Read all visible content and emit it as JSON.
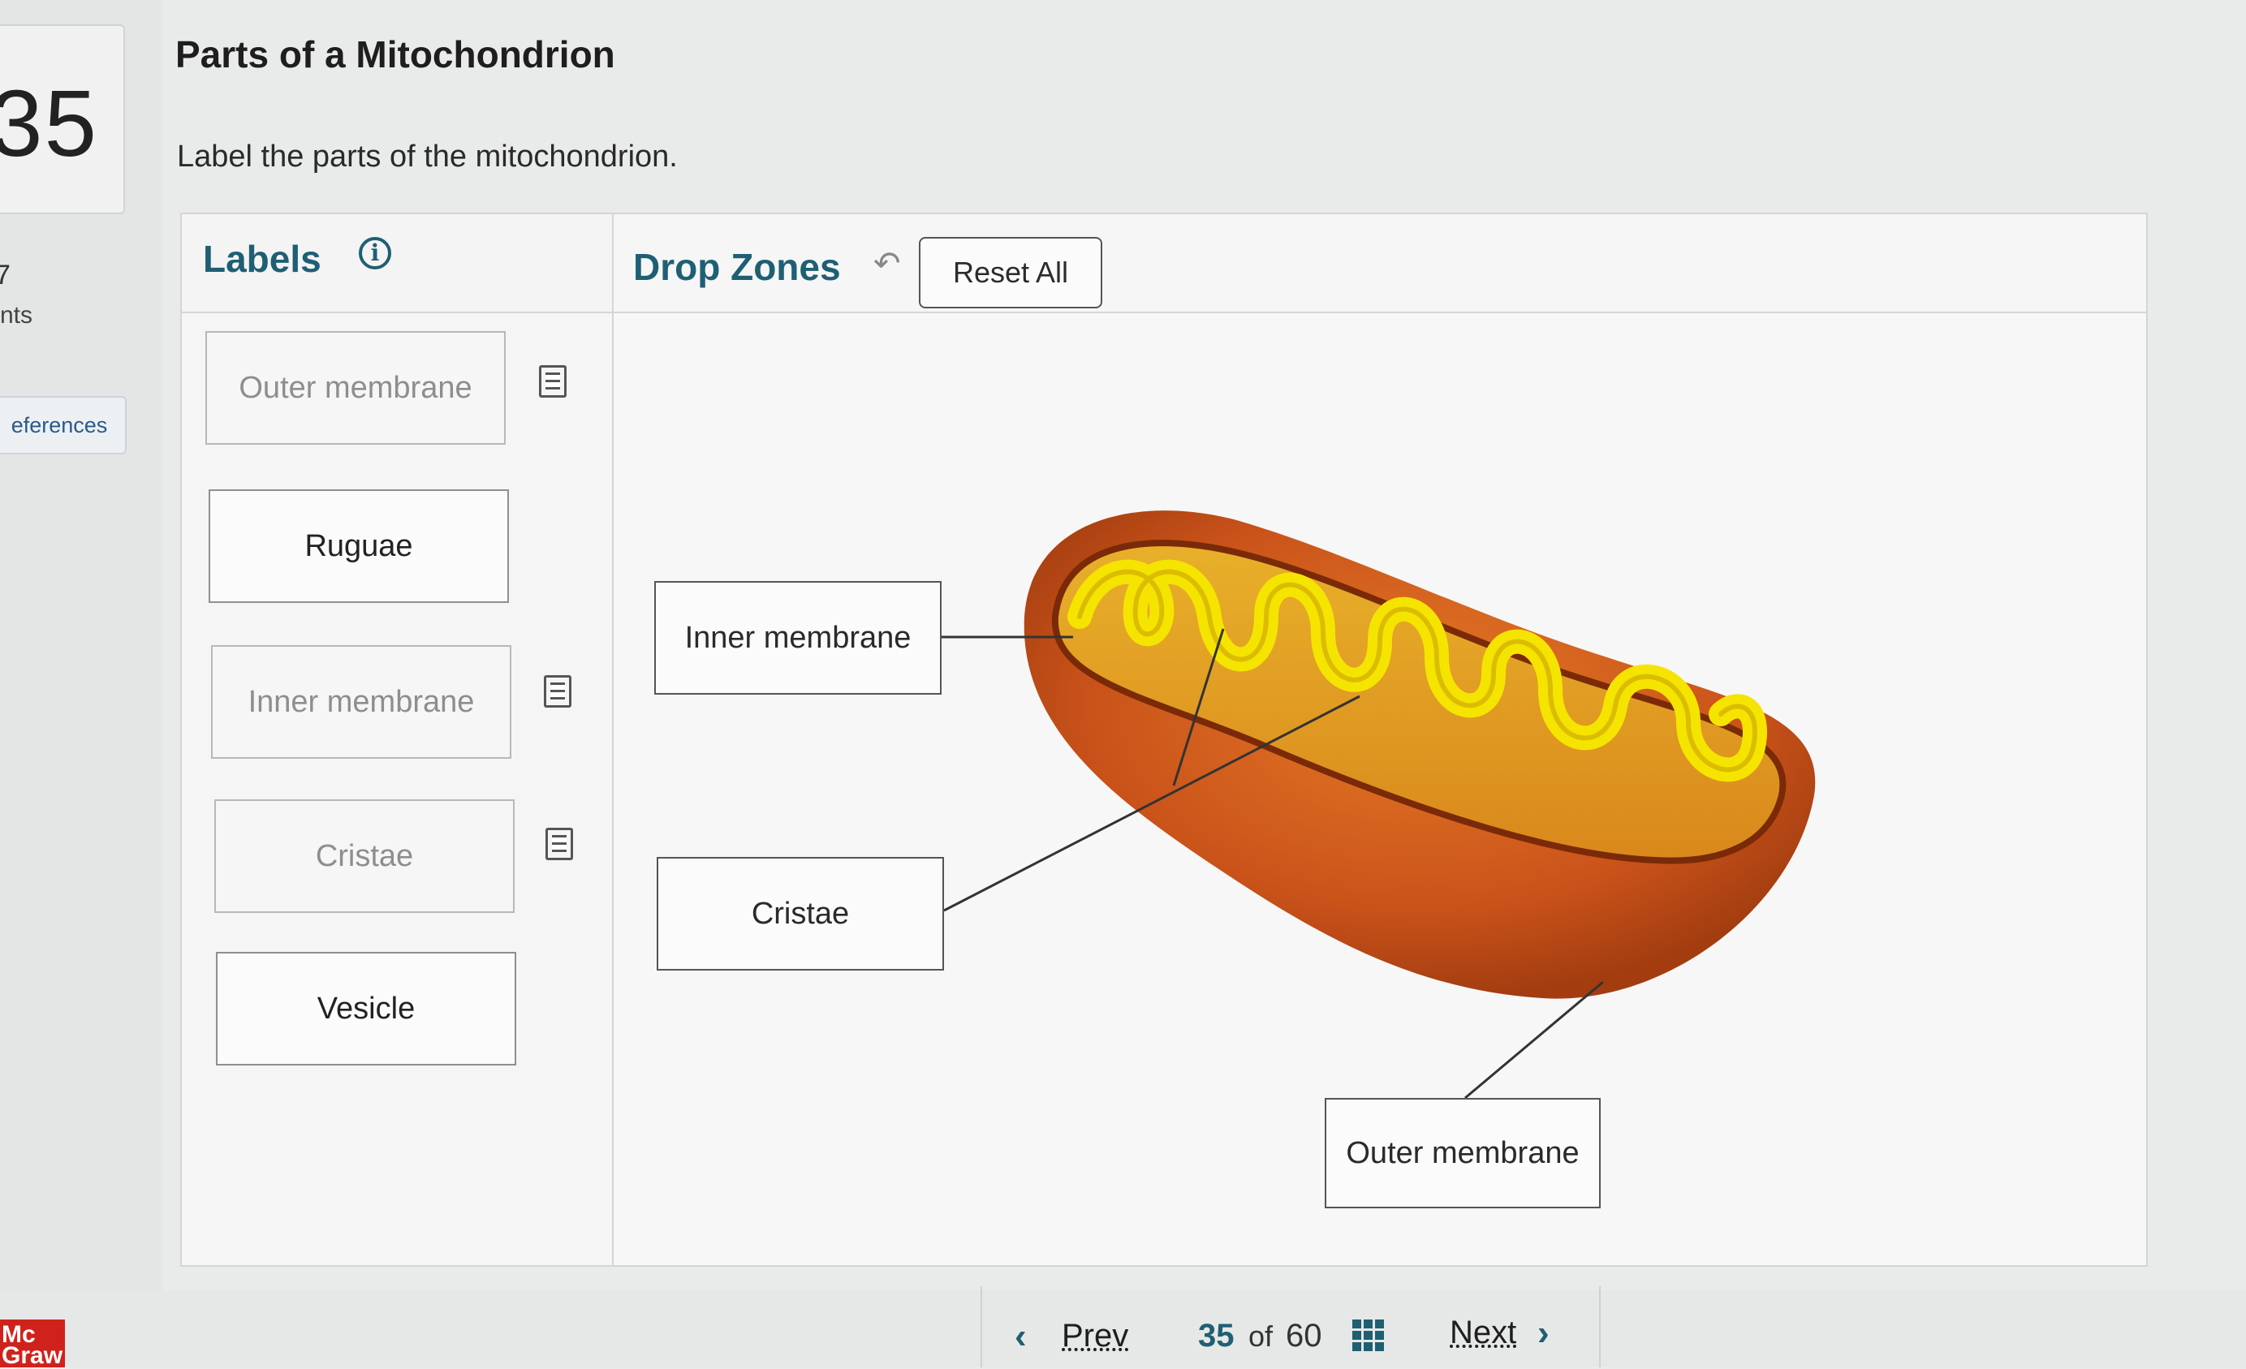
{
  "sidebar": {
    "question_number": "35",
    "points_value": "7",
    "points_label": "nts",
    "references_label": "eferences",
    "logo_text": "Mc Graw"
  },
  "header": {
    "title": "Parts of a Mitochondrion",
    "instructions": "Label the parts of the mitochondrion."
  },
  "labels_panel": {
    "title": "Labels",
    "info_icon": "info-icon",
    "items": [
      {
        "text": "Outer membrane",
        "used": true
      },
      {
        "text": "Ruguae",
        "used": false
      },
      {
        "text": "Inner membrane",
        "used": true
      },
      {
        "text": "Cristae",
        "used": true
      },
      {
        "text": "Vesicle",
        "used": false
      }
    ]
  },
  "drop_panel": {
    "title": "Drop Zones",
    "undo_icon": "undo-icon",
    "reset_label": "Reset All",
    "zones": [
      {
        "text": "Inner membrane"
      },
      {
        "text": "Cristae"
      },
      {
        "text": "Outer membrane"
      }
    ]
  },
  "pager": {
    "prev_label": "Prev",
    "current": "35",
    "of": "of",
    "total": "60",
    "next_label": "Next"
  },
  "colors": {
    "accent": "#1f5f73",
    "outer_membrane": "#c4501a",
    "inner_membrane": "#f2d90c",
    "logo": "#d0221c"
  }
}
